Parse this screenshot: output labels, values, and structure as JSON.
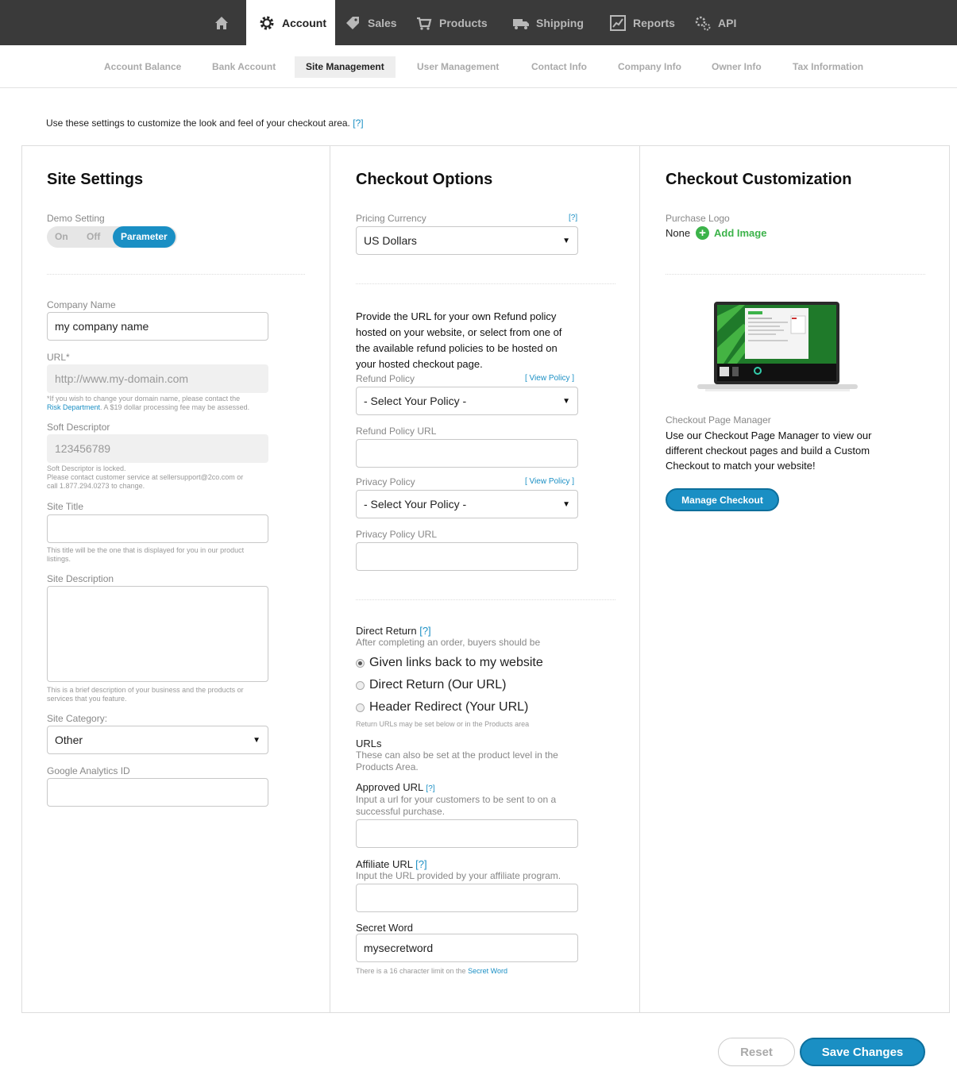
{
  "topnav": {
    "items": [
      {
        "label": "",
        "icon": "home-icon"
      },
      {
        "label": "Account",
        "icon": "gear-icon"
      },
      {
        "label": "Sales",
        "icon": "tag-icon"
      },
      {
        "label": "Products",
        "icon": "cart-icon"
      },
      {
        "label": "Shipping",
        "icon": "truck-icon"
      },
      {
        "label": "Reports",
        "icon": "chart-icon"
      },
      {
        "label": "API",
        "icon": "gears-icon"
      }
    ],
    "active": "Account"
  },
  "subnav": {
    "tabs": [
      "Account Balance",
      "Bank Account",
      "Site Management",
      "User Management",
      "Contact Info",
      "Company Info",
      "Owner Info",
      "Tax Information"
    ],
    "active": "Site Management"
  },
  "intro": {
    "text": "Use these settings to customize the look and feel of your checkout area.",
    "help": "[?]"
  },
  "site_settings": {
    "title": "Site Settings",
    "demo_label": "Demo Setting",
    "demo_options": [
      "On",
      "Off",
      "Parameter"
    ],
    "demo_selected": "Parameter",
    "company_name_label": "Company Name",
    "company_name_value": "my company name",
    "url_label": "URL*",
    "url_placeholder": "http://www.my-domain.com",
    "url_note_1": "*If you wish to change your domain name, please contact the",
    "url_note_link": "Risk Department",
    "url_note_2": ". A $19 dollar processing fee may be assessed.",
    "soft_descriptor_label": "Soft Descriptor",
    "soft_descriptor_value": "123456789",
    "soft_note_1": "Soft Descriptor is locked.",
    "soft_note_2": "Please contact customer service at sellersupport@2co.com or",
    "soft_note_3": "call 1.877.294.0273 to change.",
    "site_title_label": "Site Title",
    "site_title_note_1": "This title will be the one that is displayed for you in our product",
    "site_title_note_2": "listings.",
    "site_desc_label": "Site Description",
    "site_desc_note_1": "This is a brief description of your business and the products or",
    "site_desc_note_2": "services that you feature.",
    "site_category_label": "Site Category:",
    "site_category_value": "Other",
    "ga_label": "Google Analytics ID"
  },
  "checkout_options": {
    "title": "Checkout Options",
    "pricing_label": "Pricing Currency",
    "pricing_help": "[?]",
    "pricing_value": "US Dollars",
    "refund_text_1": "Provide the URL for your own Refund policy",
    "refund_text_2": "hosted on your website, or select from one of",
    "refund_text_3": "the available refund policies to be hosted on",
    "refund_text_4": "your hosted checkout page.",
    "refund_policy_label": "Refund Policy",
    "view_policy": "[ View Policy ]",
    "refund_policy_value": "- Select Your Policy -",
    "refund_url_label": "Refund Policy URL",
    "privacy_policy_label": "Privacy Policy",
    "privacy_policy_value": "- Select Your Policy -",
    "privacy_url_label": "Privacy Policy URL",
    "direct_return_label": "Direct Return",
    "direct_return_help": "[?]",
    "direct_return_sub": "After completing an order, buyers should be",
    "radio_options": [
      "Given links back to my website",
      "Direct Return (Our URL)",
      "Header Redirect (Your URL)"
    ],
    "radio_selected": 0,
    "return_note": "Return URLs may be set below or in the Products area",
    "urls_label": "URLs",
    "urls_sub_1": "These can also be set at the product level in the",
    "urls_sub_2": "Products Area.",
    "approved_label": "Approved URL",
    "approved_help": "[?]",
    "approved_sub_1": "Input a url for your customers to be sent to on a",
    "approved_sub_2": "successful purchase.",
    "affiliate_label": "Affiliate URL",
    "affiliate_help": "[?]",
    "affiliate_sub": "Input the URL provided by your affiliate program.",
    "secret_label": "Secret Word",
    "secret_value": "mysecretword",
    "secret_note": "There is a 16 character limit on the",
    "secret_note_link": "Secret Word"
  },
  "checkout_customization": {
    "title": "Checkout Customization",
    "logo_label": "Purchase Logo",
    "logo_value": "None",
    "add_image": "Add Image",
    "manager_label": "Checkout Page Manager",
    "manager_text_1": "Use our Checkout Page Manager to view our",
    "manager_text_2": "different checkout pages and build a Custom",
    "manager_text_3": "Checkout to match your website!",
    "manage_button": "Manage Checkout"
  },
  "footer": {
    "reset": "Reset",
    "save": "Save Changes"
  },
  "colors": {
    "accent": "#1a8fc4",
    "nav_bg": "#3a3a3a",
    "green": "#3cb34a"
  }
}
